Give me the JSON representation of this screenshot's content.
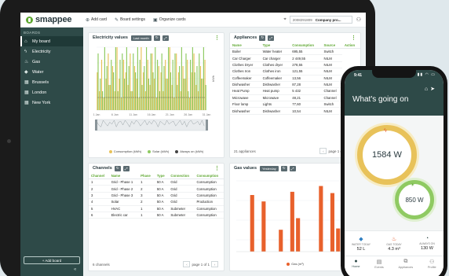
{
  "brand": {
    "name": "smappee",
    "accent": "#5fa832",
    "dark": "#2e4a48"
  },
  "topbar": {
    "add_card": "Add card",
    "board_settings": "Board settings",
    "organize_cards": "Organize cards",
    "location_id": "2008291809",
    "location_name": "Company pro..."
  },
  "sidebar": {
    "heading": "BOARDS",
    "items": [
      {
        "label": "My board",
        "icon": "home-icon"
      },
      {
        "label": "Electricity",
        "icon": "bolt-icon"
      },
      {
        "label": "Gas",
        "icon": "flame-icon"
      },
      {
        "label": "Water",
        "icon": "drop-icon"
      },
      {
        "label": "Brussels",
        "icon": "grid-icon"
      },
      {
        "label": "London",
        "icon": "grid-icon"
      },
      {
        "label": "New York",
        "icon": "grid-icon"
      }
    ],
    "add_board": "+ Add board"
  },
  "electricity_card": {
    "title": "Electricity values",
    "period": "Last month",
    "legend": [
      "Consumption (kWh)",
      "Solar (kWh)",
      "Always on (kWh)"
    ],
    "y_unit": "kWh",
    "x_ticks": [
      "1 Jan",
      "6 Jan",
      "11 Jan",
      "16 Jan",
      "21 Jan",
      "26 Jan",
      "31 Jan"
    ]
  },
  "appliances_card": {
    "title": "Appliances",
    "columns": [
      "Name",
      "Type",
      "Consumption",
      "Source",
      "Action"
    ],
    "rows": [
      [
        "Boiler",
        "Water heater",
        "695,55",
        "Switch"
      ],
      [
        "Car Charger",
        "Car charger",
        "2 449,55",
        "NILM"
      ],
      [
        "Clothes Dryer",
        "Clothes dryer",
        "278,55",
        "NILM"
      ],
      [
        "Clothes Iron",
        "Clothes iron",
        "121,55",
        "NILM"
      ],
      [
        "Coffeemaker",
        "Coffeemaker",
        "13,56",
        "NILM"
      ],
      [
        "Dishwasher",
        "Dishwasher",
        "87,28",
        "NILM"
      ],
      [
        "Heat Pump",
        "Heat pump",
        "5 432",
        "Channel"
      ],
      [
        "Microwave",
        "Microwave",
        "48,21",
        "Channel"
      ],
      [
        "Floor lamp",
        "Lights",
        "77,60",
        "Switch"
      ],
      [
        "Dishwasher",
        "Dishwasher",
        "10,54",
        "NILM"
      ]
    ],
    "count": "21 appliances",
    "page": "page 1 of 3"
  },
  "channels_card": {
    "title": "Channels",
    "columns": [
      "Channel",
      "Name",
      "Phase",
      "Type",
      "Connection",
      "Consumption"
    ],
    "rows": [
      [
        "1",
        "Grid - Phase 1",
        "1",
        "50 A",
        "Grid",
        "Consumption"
      ],
      [
        "2",
        "Grid - Phase 2",
        "2",
        "50 A",
        "Grid",
        "Consumption"
      ],
      [
        "3",
        "Grid - Phase 3",
        "3",
        "50 A",
        "Grid",
        "Consumption"
      ],
      [
        "4",
        "Solar",
        "2",
        "50 A",
        "Grid",
        "Production"
      ],
      [
        "5",
        "HVAC",
        "1",
        "50 A",
        "Submeter",
        "Consumption"
      ],
      [
        "6",
        "Electric car",
        "1",
        "50 A",
        "Submeter",
        "Consumption"
      ]
    ],
    "count": "6 channels",
    "page": "page 1 of 1"
  },
  "gas_card": {
    "title": "Gas values",
    "period": "Yesterday",
    "legend": "Gas (m³)"
  },
  "phone": {
    "time": "9:41",
    "title": "What's going on",
    "main_value": "1584 W",
    "small_value": "850 W",
    "stats": [
      {
        "label": "WATER TODAY",
        "value": "52 L",
        "icon": "water-drop-icon",
        "color": "#2f7fc1"
      },
      {
        "label": "GAS TODAY",
        "value": "4.3 m³",
        "icon": "gas-flame-icon",
        "color": "#e55a2b"
      },
      {
        "label": "ALWAYS ON",
        "value": "130 W",
        "icon": "gauge-icon",
        "color": "#2e4a48"
      }
    ],
    "tabs": [
      "Home",
      "Events",
      "Appliances",
      "Profile"
    ]
  },
  "chart_data": [
    {
      "type": "bar",
      "title": "Electricity values",
      "ylabel": "kWh",
      "x_ticks": [
        "1 Jan",
        "6 Jan",
        "11 Jan",
        "16 Jan",
        "21 Jan",
        "26 Jan",
        "31 Jan"
      ],
      "series": [
        {
          "name": "Consumption (kWh)",
          "color": "#e8c25a",
          "values": [
            6,
            3,
            8,
            2,
            5,
            9,
            4,
            7,
            3,
            10,
            5,
            2,
            8,
            6,
            4,
            9,
            3,
            7,
            5,
            2,
            10,
            6,
            3,
            8,
            4,
            9,
            5,
            2,
            7,
            6,
            3,
            8,
            5,
            10,
            4,
            2,
            9,
            6,
            3,
            7,
            5,
            8,
            2,
            6,
            9,
            4,
            3,
            7,
            5,
            8
          ]
        },
        {
          "name": "Solar (kWh)",
          "color": "#8fca62",
          "values": [
            9,
            5,
            3,
            10,
            7,
            4,
            8,
            6,
            10,
            3,
            8,
            9,
            5,
            10,
            7,
            3,
            9,
            6,
            10,
            8,
            4,
            7,
            10,
            5,
            9,
            6,
            10,
            8,
            3,
            9,
            7,
            5,
            10,
            6,
            8,
            9,
            4,
            7,
            10,
            5,
            9,
            3,
            8,
            10,
            6,
            7,
            9,
            5,
            10,
            4
          ]
        },
        {
          "name": "Always on (kWh)",
          "color": "#444444",
          "values": [
            2,
            2,
            2,
            2,
            2,
            2,
            2,
            2,
            2,
            2,
            2,
            2,
            2,
            2,
            2,
            2,
            2,
            2,
            2,
            2,
            2,
            2,
            2,
            2,
            2,
            2,
            2,
            2,
            2,
            2,
            2,
            2,
            2,
            2,
            2,
            2,
            2,
            2,
            2,
            2,
            2,
            2,
            2,
            2,
            2,
            2,
            2,
            2,
            2,
            2
          ]
        }
      ],
      "ylim": [
        0,
        10
      ]
    },
    {
      "type": "bar",
      "title": "Gas values",
      "series": [
        {
          "name": "Gas (m³)",
          "color": "#e8612c",
          "values": [
            0,
            0,
            8.8,
            0,
            7.8,
            0,
            0,
            3.4,
            0,
            9.3,
            5.2,
            0,
            0,
            0,
            10.2,
            0,
            9.1,
            3.6,
            6.4,
            0
          ]
        }
      ],
      "ylim": [
        0,
        11
      ]
    }
  ]
}
